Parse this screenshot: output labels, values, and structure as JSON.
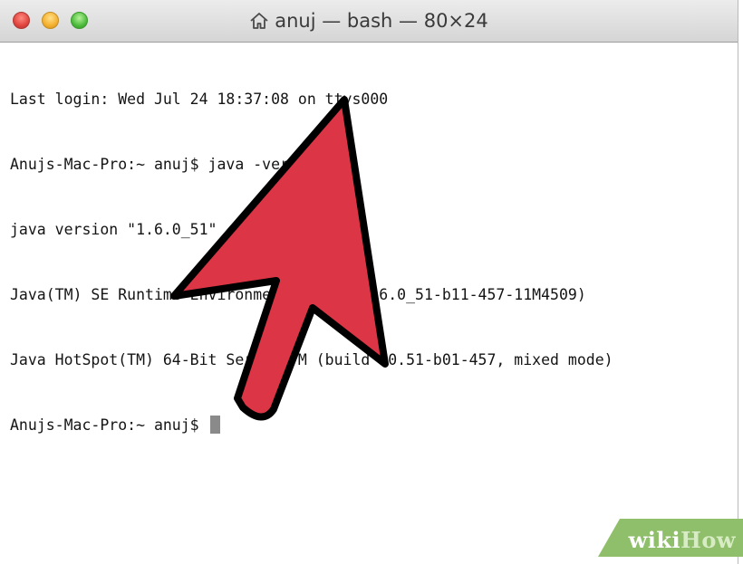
{
  "window": {
    "title": "anuj — bash — 80×24",
    "buttons": {
      "close": "close",
      "minimize": "minimize",
      "zoom": "zoom"
    },
    "title_icon": "home-icon"
  },
  "terminal": {
    "lines": [
      "Last login: Wed Jul 24 18:37:08 on ttys000",
      "Anujs-Mac-Pro:~ anuj$ java -version",
      "java version \"1.6.0_51\"",
      "Java(TM) SE Runtime Environment (build 1.6.0_51-b11-457-11M4509)",
      "Java HotSpot(TM) 64-Bit Server VM (build 20.51-b01-457, mixed mode)"
    ],
    "prompt": "Anujs-Mac-Pro:~ anuj$ "
  },
  "overlay": {
    "arrow_color": "#dc3545",
    "arrow_icon": "pointer-arrow-icon"
  },
  "watermark": {
    "wiki": "wiki",
    "how": "How",
    "background": "#8fbf6b"
  }
}
